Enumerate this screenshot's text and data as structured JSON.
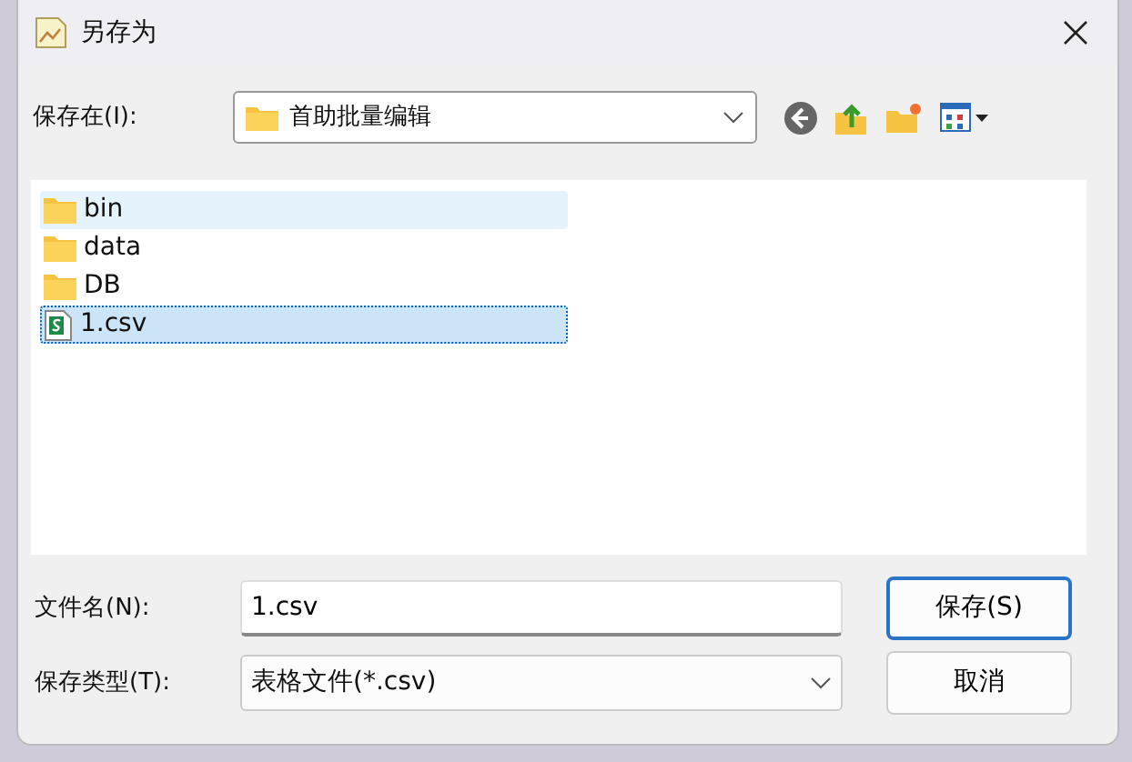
{
  "window": {
    "title": "另存为"
  },
  "location": {
    "label": "保存在(I):",
    "value": "首助批量编辑"
  },
  "files": [
    {
      "name": "bin",
      "kind": "folder",
      "selected": false,
      "hovered": true
    },
    {
      "name": "data",
      "kind": "folder",
      "selected": false,
      "hovered": false
    },
    {
      "name": "DB",
      "kind": "folder",
      "selected": false,
      "hovered": false
    },
    {
      "name": "1.csv",
      "kind": "csv",
      "selected": true,
      "hovered": false
    }
  ],
  "filename": {
    "label": "文件名(N):",
    "value": "1.csv"
  },
  "filetype": {
    "label": "保存类型(T):",
    "value": "表格文件(*.csv)"
  },
  "buttons": [
    {
      "label": "保存(S)",
      "default": true
    },
    {
      "label": "取消",
      "default": false
    }
  ]
}
